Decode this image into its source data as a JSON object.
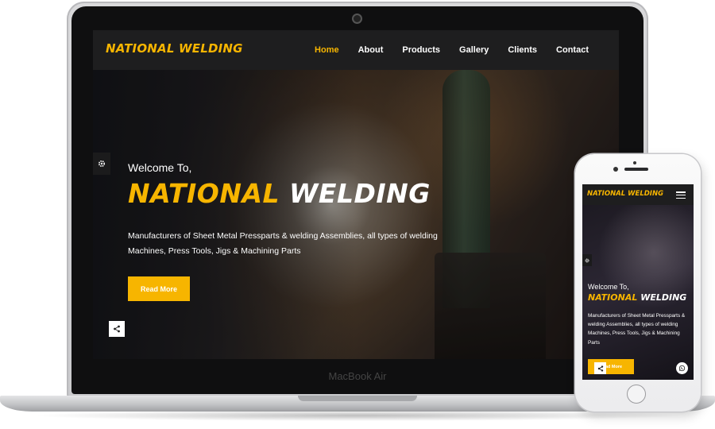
{
  "brand": {
    "name": "NATIONAL WELDING",
    "name_part1": "NATIONAL",
    "name_part2": "WELDING",
    "accent_color": "#f7b500"
  },
  "laptop": {
    "label": "MacBook Air",
    "nav": {
      "items": [
        {
          "label": "Home",
          "active": true
        },
        {
          "label": "About",
          "active": false
        },
        {
          "label": "Products",
          "active": false
        },
        {
          "label": "Gallery",
          "active": false
        },
        {
          "label": "Clients",
          "active": false
        },
        {
          "label": "Contact",
          "active": false
        }
      ]
    },
    "hero": {
      "welcome": "Welcome To,",
      "description": "Manufacturers of Sheet Metal Pressparts & welding Assemblies, all types of welding Machines, Press Tools, Jigs & Machining Parts",
      "button_label": "Read More"
    },
    "icons": {
      "settings": "gear-icon",
      "share": "share-icon"
    }
  },
  "phone": {
    "hero": {
      "welcome": "Welcome To,",
      "description": "Manufacturers of Sheet Metal Pressparts & welding Assemblies, all types of welding Machines, Press Tools, Jigs & Machining Parts",
      "button_label": "Read More"
    },
    "icons": {
      "menu": "hamburger-menu-icon",
      "settings": "gear-icon",
      "share": "share-icon",
      "whatsapp": "whatsapp-icon"
    }
  }
}
